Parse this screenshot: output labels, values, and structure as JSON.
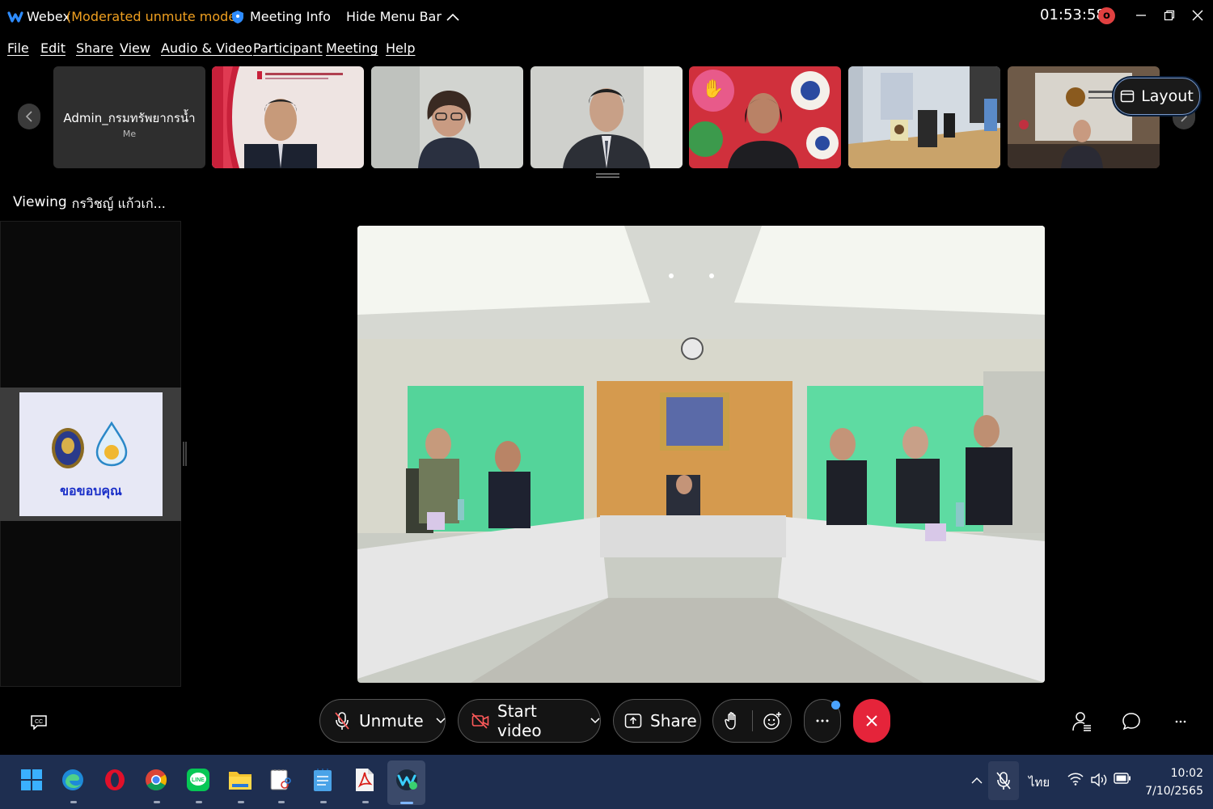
{
  "titlebar": {
    "app_name": "Webex",
    "mode": "(Moderated unmute mode)",
    "meeting_info": "Meeting Info",
    "hide_menu": "Hide Menu Bar",
    "timer": "01:53:58",
    "rec_badge": "o"
  },
  "menu": [
    "File",
    "Edit",
    "Share",
    "View",
    "Audio & Video",
    "Participant",
    "Meeting",
    "Help"
  ],
  "strip": {
    "self_name": "Admin_กรมทรัพยากรน้ำ",
    "self_label": "Me",
    "layout_label": "Layout"
  },
  "viewing": {
    "label": "Viewing",
    "name": "กรวิชญ์ แก้วเก่..."
  },
  "shared_slide": {
    "text": "ขอขอบคุณ"
  },
  "controls": {
    "unmute": "Unmute",
    "start_video": "Start video",
    "share": "Share"
  },
  "taskbar": {
    "language": "ไทย",
    "time": "10:02",
    "date": "7/10/2565"
  },
  "colors": {
    "mode_text": "#f0a020",
    "leave_button": "#e5243a",
    "accent": "#4aa3ff",
    "taskbar": "#1e2e50"
  }
}
